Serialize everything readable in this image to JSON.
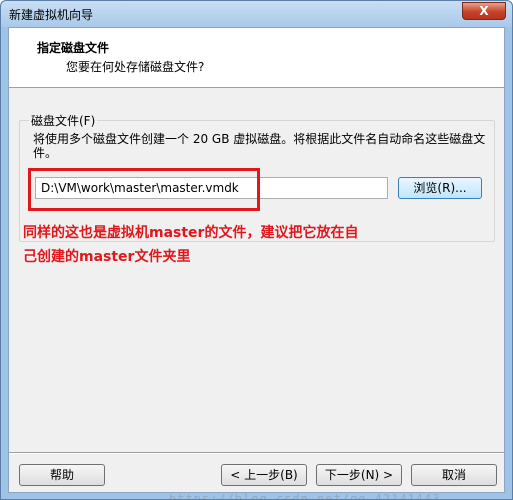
{
  "window": {
    "title": "新建虚拟机向导",
    "close_glyph": "X"
  },
  "header": {
    "title": "指定磁盘文件",
    "subtitle": "您要在何处存储磁盘文件?"
  },
  "disk_file": {
    "group_label": "磁盘文件(F)",
    "description": "将使用多个磁盘文件创建一个 20 GB 虚拟磁盘。将根据此文件名自动命名这些磁盘文件。",
    "path_value": "D:\\VM\\work\\master\\master.vmdk",
    "browse_label": "浏览(R)..."
  },
  "annotation": {
    "line1": "同样的这也是虚拟机master的文件，建议把它放在自",
    "line2": "己创建的master文件夹里",
    "color": "#e0181d"
  },
  "footer": {
    "help_label": "帮助",
    "back_label": "< 上一步(B)",
    "next_label": "下一步(N) >",
    "cancel_label": "取消"
  },
  "watermark": "https://blog.csdn.net/qq_42141443"
}
